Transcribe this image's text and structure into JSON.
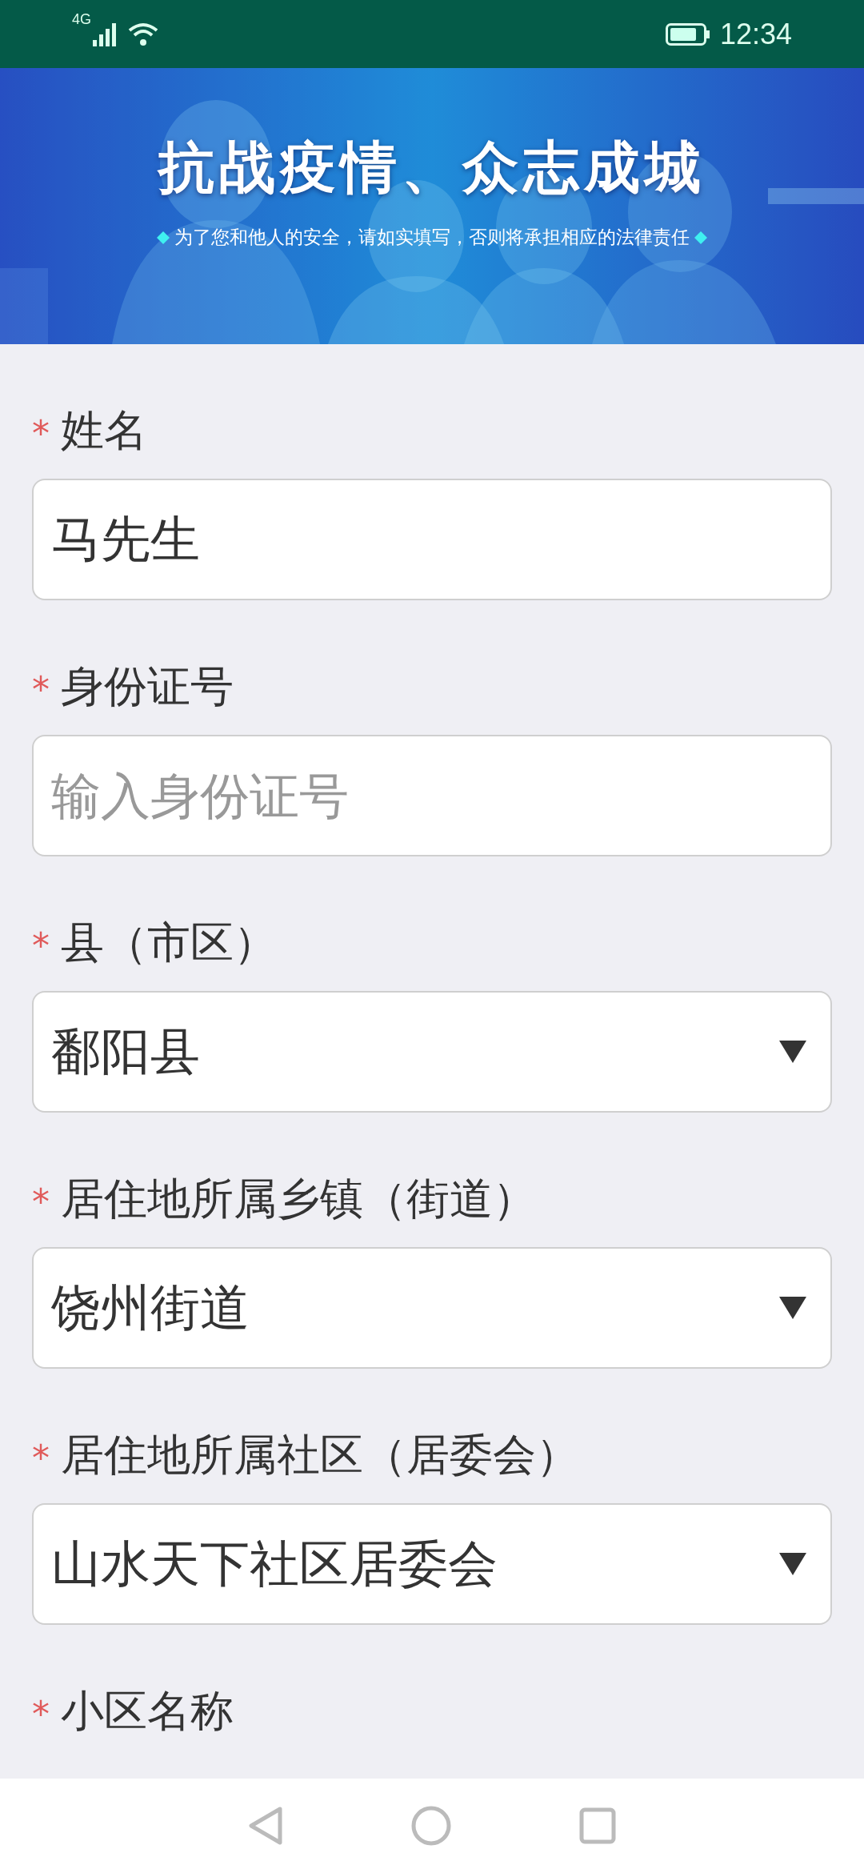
{
  "status_bar": {
    "network": "4G",
    "time": "12:34"
  },
  "banner": {
    "kind": "picture",
    "title": "抗战疫情、众志成城",
    "subtitle": "为了您和他人的安全，请如实填写，否则将承担相应的法律责任"
  },
  "fields": [
    {
      "kind": "text",
      "required": true,
      "marker": "*",
      "label": "姓名",
      "value": "马先生"
    },
    {
      "kind": "text",
      "required": true,
      "marker": "*",
      "label": "身份证号",
      "placeholder": "输入身份证号"
    },
    {
      "kind": "select",
      "required": true,
      "marker": "*",
      "label": "县（市区）",
      "value": "鄱阳县"
    },
    {
      "kind": "select",
      "required": true,
      "marker": "*",
      "label": "居住地所属乡镇（街道）",
      "value": "饶州街道"
    },
    {
      "kind": "select",
      "required": true,
      "marker": "*",
      "label": "居住地所属社区（居委会）",
      "value": "山水天下社区居委会"
    },
    {
      "kind": "none",
      "required": true,
      "marker": "*",
      "label": "小区名称"
    }
  ]
}
